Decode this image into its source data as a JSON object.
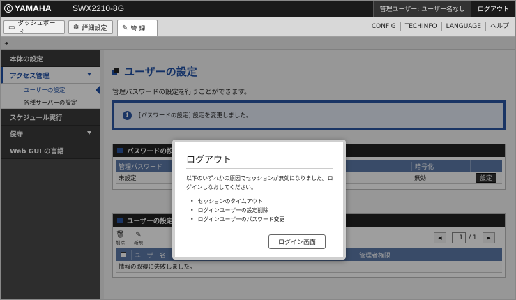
{
  "header": {
    "brand": "YAMAHA",
    "model": "SWX2210-8G",
    "user": "管理ユーザー: ユーザー名なし",
    "logout": "ログアウト"
  },
  "tabs": [
    {
      "label": "ダッシュボード",
      "icon": "dashboard-icon"
    },
    {
      "label": "詳細設定",
      "icon": "gear-icon"
    },
    {
      "label": "管 理",
      "icon": "wrench-icon",
      "active": true
    }
  ],
  "top_menu": [
    "CONFIG",
    "TECHINFO",
    "LANGUAGE",
    "ヘルプ"
  ],
  "collapse_label": "◂◂",
  "sidebar": {
    "items": [
      {
        "label": "本体の設定"
      },
      {
        "label": "アクセス管理",
        "active": true,
        "expanded": true
      },
      {
        "label": "スケジュール実行"
      },
      {
        "label": "保守",
        "expandable": true
      },
      {
        "label": "Web GUI の言語"
      }
    ],
    "subitems": [
      {
        "label": "ユーザーの設定",
        "active": true
      },
      {
        "label": "各種サーバーの設定"
      }
    ]
  },
  "main": {
    "title": "ユーザーの設定",
    "description": "管理パスワードの設定を行うことができます。",
    "info_message": "[パスワードの設定] 設定を変更しました。",
    "password_panel": {
      "title": "パスワードの設",
      "col_password": "管理パスワード",
      "col_encrypt": "暗号化",
      "value_password": "未設定",
      "value_encrypt": "無効",
      "button": "設定"
    },
    "user_panel": {
      "title": "ユーザーの設定",
      "delete_label": "削除",
      "new_label": "新規",
      "page_current": "1",
      "page_total": "1",
      "col_username": "ユーザー名",
      "col_admin": "管理者権限",
      "error": "情報の取得に失敗しました。"
    }
  },
  "modal": {
    "title": "ログアウト",
    "message": "以下のいずれかの原因でセッションが無効になりました。ログインしなおしてください。",
    "reasons": [
      "セッションのタイムアウト",
      "ログインユーザーの設定削除",
      "ログインユーザーのパスワード変更"
    ],
    "button": "ログイン画面"
  },
  "colors": {
    "accent": "#1f4fa5",
    "header_bg": "#1a1a1a",
    "sidebar_bg": "#3a3a3a",
    "table_header": "#5d7aa8"
  }
}
